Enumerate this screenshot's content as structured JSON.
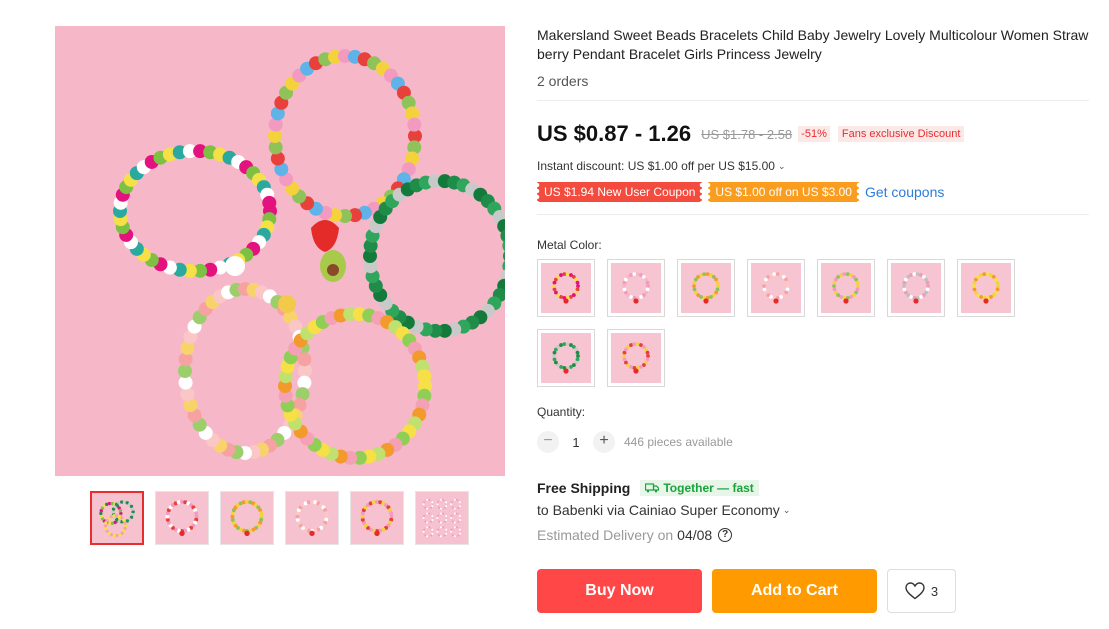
{
  "product": {
    "title": "Makersland Sweet Beads Bracelets Child Baby Jewelry Lovely Multicolour Women Strawberry Pendant Bracelet Girls Princess Jewelry",
    "orders": "2 orders"
  },
  "price": {
    "current": "US $0.87 - 1.26",
    "original": "US $1.78 - 2.58",
    "discount_pct": "-51%",
    "fans_badge": "Fans exclusive Discount"
  },
  "instant_discount": "Instant discount: US $1.00 off per US $15.00",
  "coupons": {
    "new_user": "US $1.94 New User Coupon",
    "off": "US $1.00 off on US $3.00",
    "get_coupons": "Get coupons"
  },
  "variants": {
    "label": "Metal Color:",
    "count": 9
  },
  "quantity": {
    "label": "Quantity:",
    "minus": "−",
    "value": "1",
    "plus": "+",
    "available": "446 pieces available"
  },
  "shipping": {
    "title": "Free Shipping",
    "together_badge": "Together — fast",
    "destination": "to Babenki via Cainiao Super Economy",
    "eta_label": "Estimated Delivery on",
    "eta_date": "04/08",
    "help_icon": "?"
  },
  "actions": {
    "buy_now": "Buy Now",
    "add_to_cart": "Add to Cart",
    "wishlist_count": "3"
  },
  "colors": {
    "accent_red": "#ff4747",
    "accent_orange": "#ff9a00",
    "link_blue": "#2e7cd8",
    "green_badge": "#1ba33b",
    "product_bg": "#f6b8c8"
  },
  "icons": {
    "chevron": "chevron-down-icon",
    "heart": "heart-icon",
    "truck": "truck-icon",
    "help": "question-circle-icon"
  }
}
